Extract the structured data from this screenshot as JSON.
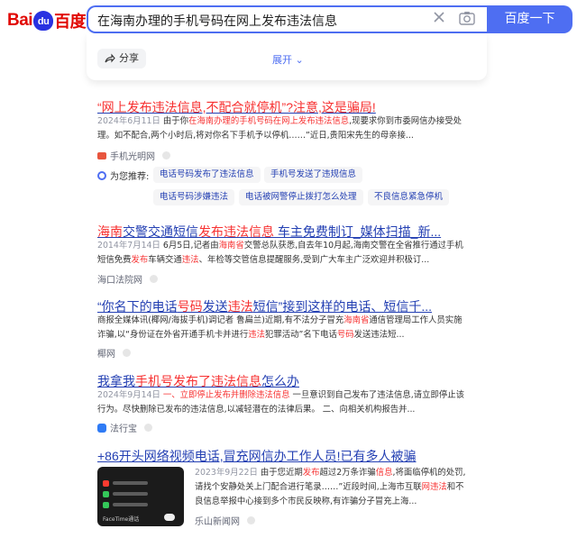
{
  "header": {
    "logo_bai": "Bai",
    "logo_paw": "du",
    "logo_du": "百度",
    "query": "在海南办理的手机号码在网上发布违法信息",
    "search_button": "百度一下"
  },
  "toolbar": {
    "share_label": "分享",
    "expand_label": "展开"
  },
  "results": [
    {
      "title_parts": [
        "“网上发布违法信息,不配合就停机”?注意,这是骗局!"
      ],
      "date": "2024年6月11日",
      "desc_a": "由于你",
      "desc_hl1": "在海南办理的手机号码在网上发布违法信息",
      "desc_b": ",现要求你到市委网信办接受处",
      "desc_line2": "理。如不配合,两个小时后,将对你名下手机予以停机……”近日,贵阳宋先生的母亲接...",
      "source": "手机光明网"
    },
    {
      "title_a": "海南",
      "title_b": "交警交通短信",
      "title_c": "发布违法信息",
      "title_d": " 车主免费制订_媒体扫描_新...",
      "date": "2014年7月14日",
      "desc_a": "6月5日,记者由",
      "desc_hl1": "海南省",
      "desc_b": "交警总队获悉,自去年10月起,海南交警在全省推行通过手机",
      "desc_line2_a": "短信免费",
      "desc_line2_hl": "发布",
      "desc_line2_b": "车辆交通",
      "desc_line2_hl2": "违法",
      "desc_line2_c": "、年检等交管信息提醒服务,受到广大车主广泛欢迎并积极订...",
      "source": "海口法院网"
    },
    {
      "title_a": "“你名下的电话",
      "title_b": "号码",
      "title_c": "发送",
      "title_d": "违法",
      "title_e": "短信",
      "title_f": "”接到这样的电话、短信千...",
      "desc_line1_a": "商报全媒体讯(椰网/海拔手机)调记者 鲁扁兰)近期,有不法分子冒充",
      "desc_line1_hl": "海南省",
      "desc_line1_b": "通信管理局工作人员实施",
      "desc_line2_a": "诈骗,以“身份证在外省开通手机卡并进行",
      "desc_line2_hl": "违法",
      "desc_line2_b": "犯罪活动”名下电话",
      "desc_line2_hl2": "号码",
      "desc_line2_c": "发送违法短...",
      "source": "椰网"
    },
    {
      "title_a": "我拿我",
      "title_b": "手机号发布了违法信息",
      "title_c": "怎么办",
      "date": "2024年9月14日",
      "desc_hl1": "一、立即停止发布并删除违法信息",
      "desc_b": " 一旦意识到自己发布了违法信息,请立即停止该",
      "desc_line2": "行为。尽快删除已发布的违法信息,以减轻潜在的法律后果。 二、向相关机构报告并...",
      "source": "法行宝"
    },
    {
      "title_a": "+86开头网络视频电话,冒充网信办工作人员!已有多人被骗",
      "date": "2023年9月22日",
      "desc_a": "由于您近期",
      "desc_hl1": "发布",
      "desc_b": "超过2万条诈骗",
      "desc_hl2": "信息",
      "desc_c": ",将面临停机的处罚,",
      "desc_line2": "请找个安静处关上门配合进行笔录……”近段时间,上海市互联",
      "desc_line2_hl": "网违法",
      "desc_line2_b": "和不",
      "desc_line3": "良信息举报中心接到多个市民反映称,有诈骗分子冒充上海...",
      "source": "乐山新闻网"
    }
  ],
  "recommend": {
    "label": "为您推荐:",
    "tags": [
      "电话号码发布了违法信息",
      "手机号发送了违规信息",
      "电话号码涉嫌违法",
      "电话被网警停止拨打怎么处理",
      "不良信息紧急停机"
    ]
  },
  "thumbnail": {
    "caption": "FaceTime通话"
  }
}
